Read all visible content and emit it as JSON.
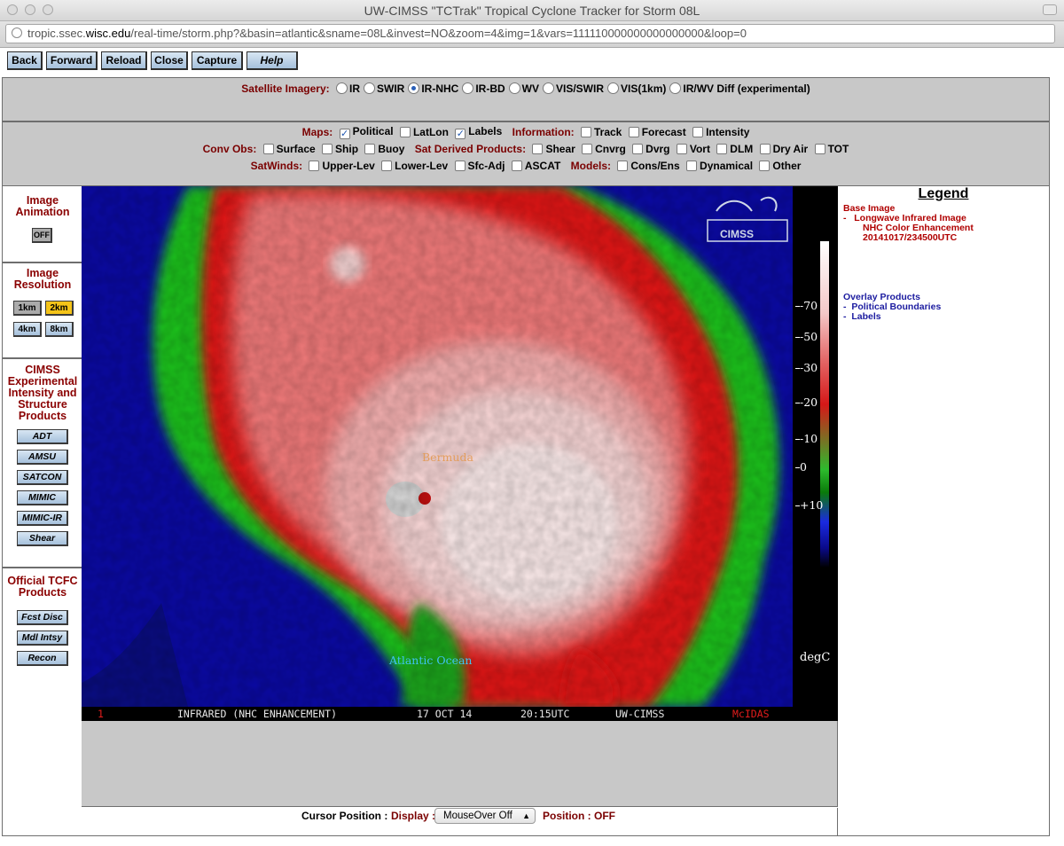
{
  "window": {
    "title": "UW-CIMSS \"TCTrak\" Tropical Cyclone Tracker for Storm 08L",
    "url_host": "tropic.ssec.",
    "url_domain": "wisc.edu",
    "url_rest": "/real-time/storm.php?&basin=atlantic&sname=08L&invest=NO&zoom=4&img=1&vars=111110000000000000000&loop=0"
  },
  "nav": {
    "back": "Back",
    "forward": "Forward",
    "reload": "Reload",
    "close": "Close",
    "capture": "Capture",
    "help": "Help"
  },
  "imagery": {
    "label": "Satellite Imagery:",
    "options": [
      {
        "label": "IR",
        "selected": false
      },
      {
        "label": "SWIR",
        "selected": false
      },
      {
        "label": "IR-NHC",
        "selected": true
      },
      {
        "label": "IR-BD",
        "selected": false
      },
      {
        "label": "WV",
        "selected": false
      },
      {
        "label": "VIS/SWIR",
        "selected": false
      },
      {
        "label": "VIS(1km)",
        "selected": false
      },
      {
        "label": "IR/WV Diff (experimental)",
        "selected": false
      }
    ]
  },
  "overlays": {
    "maps_label": "Maps:",
    "political": "Political",
    "political_checked": true,
    "latlon": "LatLon",
    "latlon_checked": false,
    "labels": "Labels",
    "labels_checked": true,
    "information_label": "Information:",
    "track": "Track",
    "forecast": "Forecast",
    "intensity": "Intensity",
    "convobs_label": "Conv Obs:",
    "surface": "Surface",
    "ship": "Ship",
    "buoy": "Buoy",
    "satderived_label": "Sat Derived Products:",
    "shear": "Shear",
    "cnvrg": "Cnvrg",
    "dvrg": "Dvrg",
    "vort": "Vort",
    "dlm": "DLM",
    "dryair": "Dry Air",
    "tot": "TOT",
    "satwinds_label": "SatWinds:",
    "upperlev": "Upper-Lev",
    "lowerlev": "Lower-Lev",
    "sfcadj": "Sfc-Adj",
    "ascat": "ASCAT",
    "models_label": "Models:",
    "consens": "Cons/Ens",
    "dynamical": "Dynamical",
    "other": "Other"
  },
  "sidebar": {
    "animation_title": "Image Animation",
    "animation_toggle": "OFF",
    "resolution_title": "Image Resolution",
    "res_1km": "1km",
    "res_2km": "2km",
    "res_4km": "4km",
    "res_8km": "8km",
    "cimss_title": "CIMSS Experimental Intensity and Structure Products",
    "adt": "ADT",
    "amsu": "AMSU",
    "satcon": "SATCON",
    "mimic": "MIMIC",
    "mimicir": "MIMIC-IR",
    "shear": "Shear",
    "tcfc_title": "Official TCFC Products",
    "fcstdisc": "Fcst Disc",
    "mdlintsy": "Mdl Intsy",
    "recon": "Recon"
  },
  "image": {
    "frame_number": "1",
    "product": "INFRARED (NHC ENHANCEMENT)",
    "date": "17 OCT 14",
    "time": "20:15UTC",
    "source": "UW-CIMSS",
    "software": "McIDAS",
    "label_bermuda": "Bermuda",
    "label_ocean": "Atlantic Ocean",
    "logo_text": "CIMSS"
  },
  "colorbar": {
    "ticks": [
      "-70",
      "-50",
      "-30",
      "-20",
      "-10",
      "0",
      "+10"
    ],
    "unit": "degC"
  },
  "cursor": {
    "label": "Cursor Position :",
    "display_label": "Display :",
    "display_value": "MouseOver Off",
    "position_label": "Position :",
    "position_value": "OFF"
  },
  "legend": {
    "title": "Legend",
    "base_header": "Base Image",
    "base_item": "Longwave Infrared Image",
    "enhancement": "NHC Color Enhancement",
    "datetime": "20141017/234500UTC",
    "overlay_header": "Overlay Products",
    "overlay_items": [
      "Political Boundaries",
      "Labels"
    ],
    "bullet": "-"
  },
  "colors": {
    "section_red": "#7a0000",
    "button_blue": "#a6c1dc",
    "highlight_yellow": "#f5c419",
    "legend_red": "#b00000",
    "legend_blue": "#1c1ca0"
  }
}
